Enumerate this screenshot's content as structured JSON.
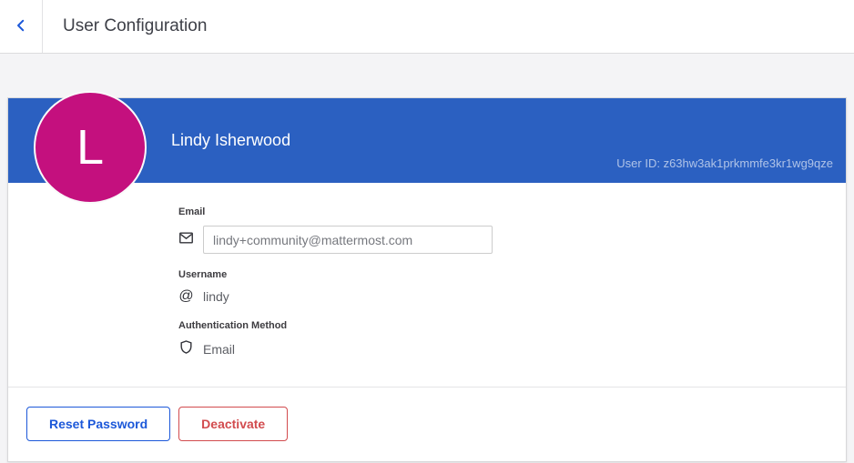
{
  "header": {
    "title": "User Configuration",
    "back_icon": "chevron-left-icon"
  },
  "user": {
    "avatar_initial": "L",
    "name": "Lindy Isherwood",
    "user_id_text": "User ID: z63hw3ak1prkmmfe3kr1wg9qze"
  },
  "profile": {
    "email": {
      "label": "Email",
      "value": "lindy+community@mattermost.com",
      "icon": "envelope-icon"
    },
    "username": {
      "label": "Username",
      "value": "lindy",
      "icon": "at-sign-icon",
      "at_glyph": "@"
    },
    "auth_method": {
      "label": "Authentication Method",
      "value": "Email",
      "icon": "shield-icon"
    }
  },
  "footer": {
    "reset_password_label": "Reset Password",
    "deactivate_label": "Deactivate"
  },
  "colors": {
    "banner_blue": "#2b60c1",
    "avatar_magenta": "#c4107e",
    "accent_blue": "#1c58d9",
    "danger_red": "#d24b4e",
    "page_background": "#f4f4f6"
  }
}
